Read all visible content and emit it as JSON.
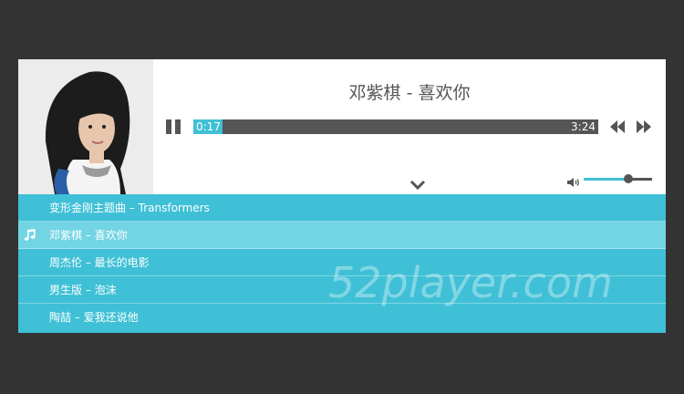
{
  "player": {
    "now_playing": "邓紫棋 - 喜欢你",
    "current_time": "0:17",
    "total_time": "3:24",
    "progress_fraction": 0.0726,
    "volume_fraction": 0.65,
    "accent_color": "#3fc0d6",
    "dark_color": "#555555",
    "controls": {
      "pause_icon": "pause-icon",
      "previous_icon": "rewind-icon",
      "next_icon": "fast-forward-icon",
      "expand_icon": "chevron-down-icon",
      "volume_icon": "speaker-icon"
    }
  },
  "playlist": {
    "active_index": 1,
    "playing_icon": "music-note-icon",
    "items": [
      {
        "label": "变形金刚主题曲 – Transformers"
      },
      {
        "label": "邓紫棋 – 喜欢你"
      },
      {
        "label": "周杰伦 – 最长的电影"
      },
      {
        "label": "男生版 – 泡沫"
      },
      {
        "label": "陶喆 – 爱我还说他"
      }
    ]
  },
  "watermark": "52player.com"
}
